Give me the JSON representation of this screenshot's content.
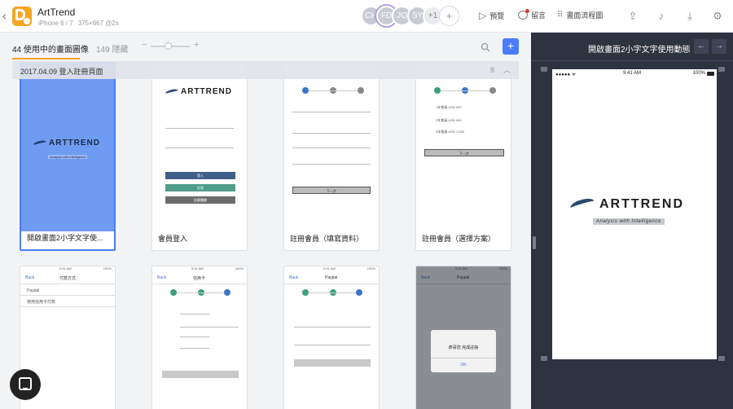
{
  "app": {
    "name": "ArtTrend",
    "device": "iPhone 6 / 7",
    "resolution": "375×667 @2x",
    "icon_color": "#f5a623"
  },
  "collaborators": [
    "CH",
    "FD",
    "JO",
    "SY"
  ],
  "collaborators_more": "+1",
  "collaborators_add": "+",
  "toolbar": {
    "preview": "預覽",
    "comment": "留言",
    "flow": "畫面流程圖"
  },
  "screens": {
    "active_label": "44 使用中的畫面圖像",
    "hidden_label": "149 隱藏",
    "zoom_minus": "−",
    "zoom_plus": "+",
    "zoom_level": 0.45,
    "add": "+"
  },
  "group": {
    "title": "2017.04.09 登入註冊頁面",
    "count": "8",
    "collapse": "︿"
  },
  "cards": [
    {
      "caption": "開啟畫面2小字文字使...",
      "selected": true
    },
    {
      "caption": "會員登入"
    },
    {
      "caption": "註冊會員（填寫資料）"
    },
    {
      "caption": "註冊會員（選擇方案）"
    }
  ],
  "thumb_text": {
    "logo": "ARTTREND",
    "tagline": "Analysis with Intelligence",
    "login_btn1": "登入",
    "login_btn2": "註冊",
    "login_btn3": "訪客體驗",
    "back": "Back",
    "payment_title": "付款方式",
    "paypal": "Paypal",
    "credit": "使用信用卡付款",
    "credit_title": "信用卡",
    "paypal_title": "Paypal",
    "done": "恭喜您 完成註冊",
    "ok": "OK",
    "next": "下一步",
    "plan1": "1年會員 USD 300",
    "plan2": "2年會員 USD 900",
    "plan3": "3年會員 USD 1,200",
    "time": "9:41 AM",
    "battery": "100%"
  },
  "preview": {
    "title": "開啟畫面2小字文字使用動態",
    "prev": "←",
    "next": "→",
    "time": "9:41 AM",
    "battery": "100%",
    "logo": "ARTTREND",
    "tagline": "Analysis with Intelligence"
  }
}
